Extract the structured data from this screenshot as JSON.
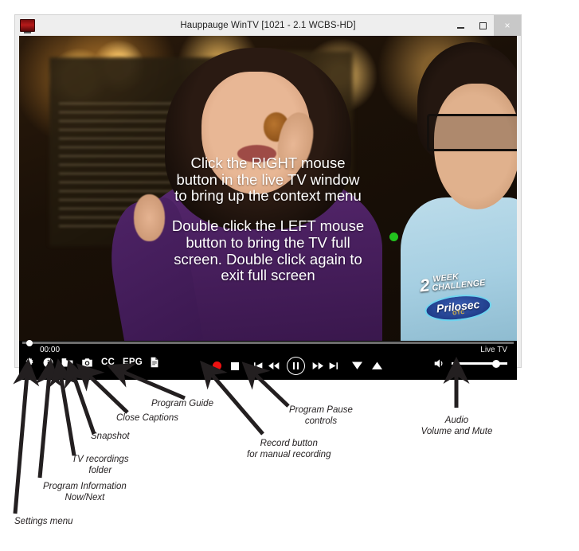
{
  "window": {
    "title": "Hauppauge WinTV [1021 - 2.1  WCBS-HD]",
    "app_icon": "tv-icon",
    "buttons": {
      "minimize": "minimize-icon",
      "maximize": "maximize-icon",
      "close": "×"
    }
  },
  "video": {
    "overlay": {
      "block1_line1": "Click the RIGHT mouse",
      "block1_line2": "button in the live TV window",
      "block1_line3": "to bring up the context menu",
      "block2_line1": "Double click the LEFT mouse",
      "block2_line2": "button to bring the TV full",
      "block2_line3": "screen. Double click again to",
      "block2_line4": "exit full screen"
    },
    "ad_badge": {
      "number": "2",
      "week": "WEEK",
      "challenge": "CHALLENGE",
      "brand": "Prilosec",
      "sub": "OTC"
    },
    "cursor_dot_color": "#22c21e"
  },
  "controls": {
    "timecode": "00:00",
    "live_label": "Live TV",
    "left_icons": [
      {
        "name": "settings-gear-icon",
        "label": "Settings"
      },
      {
        "name": "program-info-icon",
        "label": "Program Information"
      },
      {
        "name": "recordings-folder-icon",
        "label": "TV recordings folder"
      },
      {
        "name": "snapshot-camera-icon",
        "label": "Snapshot"
      },
      {
        "name": "closed-captions-icon",
        "label": "CC"
      },
      {
        "name": "epg-icon",
        "label": "EPG"
      },
      {
        "name": "document-icon",
        "label": "Document"
      }
    ],
    "cc_label": "CC",
    "epg_label": "EPG",
    "transport": [
      {
        "name": "record-button",
        "label": "Record"
      },
      {
        "name": "stop-button",
        "label": "Stop"
      },
      {
        "name": "previous-button",
        "label": "Previous"
      },
      {
        "name": "rewind-button",
        "label": "Rewind"
      },
      {
        "name": "pause-button",
        "label": "Pause"
      },
      {
        "name": "fast-forward-button",
        "label": "Fast forward"
      },
      {
        "name": "next-button",
        "label": "Next"
      },
      {
        "name": "channel-down-button",
        "label": "Channel down"
      },
      {
        "name": "channel-up-button",
        "label": "Channel up"
      }
    ],
    "volume": {
      "icon": "speaker-icon",
      "level_percent": 75
    },
    "accent_record_color": "#ee1111"
  },
  "annotations": [
    {
      "id": "settings",
      "line1": "Settings menu"
    },
    {
      "id": "program-info",
      "line1": "Program Information",
      "line2": "Now/Next"
    },
    {
      "id": "recordings",
      "line1": "TV recordings",
      "line2": "folder"
    },
    {
      "id": "snapshot",
      "line1": "Snapshot"
    },
    {
      "id": "captions",
      "line1": "Close Captions"
    },
    {
      "id": "guide",
      "line1": "Program Guide"
    },
    {
      "id": "record",
      "line1": "Record button",
      "line2": "for manual recording"
    },
    {
      "id": "pause",
      "line1": "Program Pause",
      "line2": "controls"
    },
    {
      "id": "audio",
      "line1": "Audio",
      "line2": "Volume and Mute"
    }
  ]
}
